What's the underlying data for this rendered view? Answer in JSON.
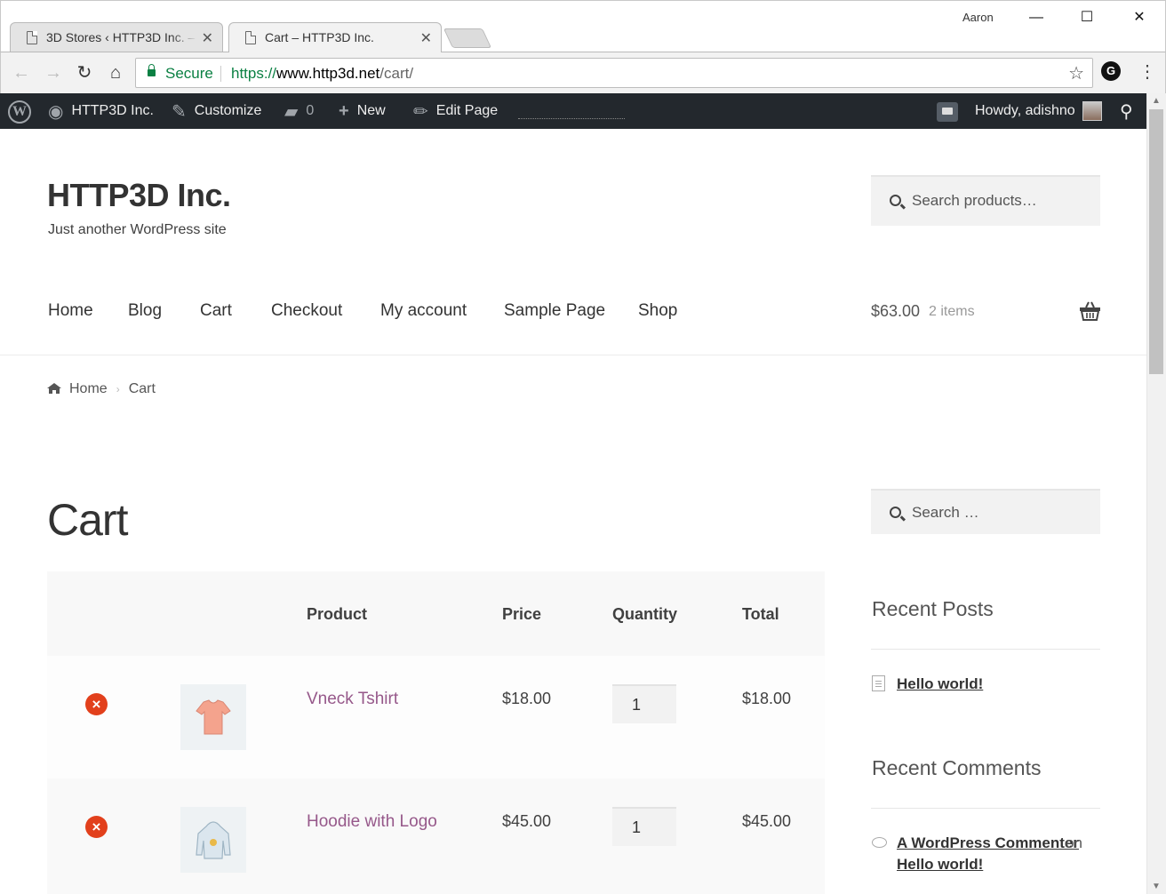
{
  "browser": {
    "tabs": [
      {
        "title": "3D Stores ‹ HTTP3D Inc. –"
      },
      {
        "title": "Cart – HTTP3D Inc."
      }
    ],
    "profile_name": "Aaron",
    "secure_label": "Secure",
    "url_scheme": "https://",
    "url_host": "www.http3d.net",
    "url_path": "/cart/"
  },
  "adminbar": {
    "site_name": "HTTP3D Inc.",
    "customize": "Customize",
    "comments_count": "0",
    "new": "New",
    "edit_page": "Edit Page",
    "howdy": "Howdy, adishno"
  },
  "site": {
    "title": "HTTP3D Inc.",
    "tagline": "Just another WordPress site",
    "search_placeholder": "Search products…"
  },
  "nav": {
    "items": [
      "Home",
      "Blog",
      "Cart",
      "Checkout",
      "My account",
      "Sample Page",
      "Shop"
    ],
    "cart_total": "$63.00",
    "cart_count": "2 items"
  },
  "breadcrumb": {
    "home": "Home",
    "current": "Cart"
  },
  "page": {
    "title": "Cart"
  },
  "cart": {
    "headers": {
      "product": "Product",
      "price": "Price",
      "quantity": "Quantity",
      "total": "Total"
    },
    "rows": [
      {
        "name": "Vneck Tshirt",
        "price": "$18.00",
        "qty": "1",
        "total": "$18.00"
      },
      {
        "name": "Hoodie with Logo",
        "price": "$45.00",
        "qty": "1",
        "total": "$45.00"
      }
    ]
  },
  "sidebar": {
    "search_placeholder": "Search …",
    "recent_posts_title": "Recent Posts",
    "recent_posts": [
      "Hello world!"
    ],
    "recent_comments_title": "Recent Comments",
    "comment_author": "A WordPress Commenter",
    "comment_on": "on",
    "comment_post": "Hello world!"
  },
  "colors": {
    "adminbar_bg": "#23282d",
    "link_purple": "#96588a",
    "secure_green": "#0b8043",
    "remove_red": "#e2401c"
  }
}
